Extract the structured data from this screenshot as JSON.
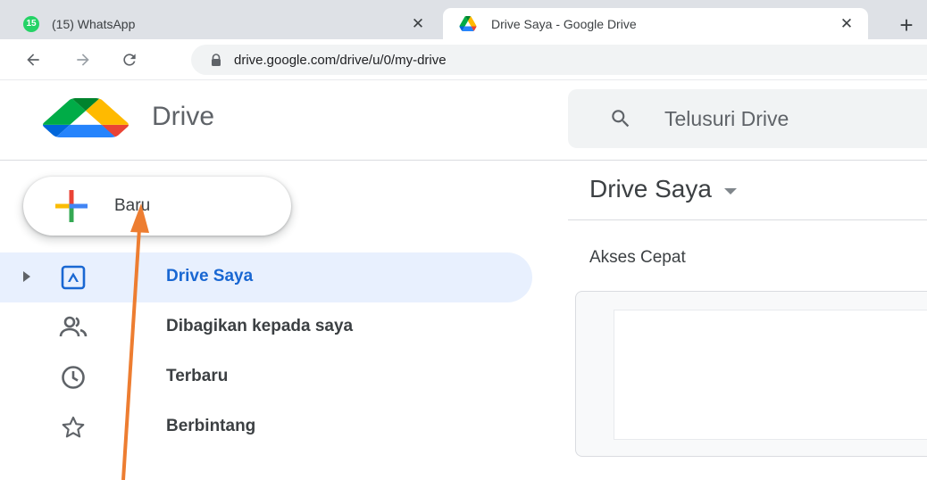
{
  "browser": {
    "tabs": [
      {
        "badge": "15",
        "title": "(15) WhatsApp",
        "close": "✕"
      },
      {
        "title": "Drive Saya - Google Drive",
        "close": "✕"
      }
    ],
    "new_tab": "+",
    "back": "←",
    "forward": "→",
    "url": "drive.google.com/drive/u/0/my-drive"
  },
  "drive": {
    "app_name": "Drive",
    "search_placeholder": "Telusuri Drive",
    "new_button": "Baru",
    "nav": [
      {
        "label": "Drive Saya",
        "icon": "my-drive-icon",
        "active": true
      },
      {
        "label": "Dibagikan kepada saya",
        "icon": "shared-people-icon"
      },
      {
        "label": "Terbaru",
        "icon": "clock-icon"
      },
      {
        "label": "Berbintang",
        "icon": "star-icon"
      }
    ],
    "main_title": "Drive Saya",
    "quick_access": "Akses Cepat"
  },
  "colors": {
    "accent_blue": "#1967d2",
    "active_nav_bg": "#e8f0fe",
    "annotation_arrow": "#ed7d31",
    "whatsapp_green": "#25d366"
  }
}
